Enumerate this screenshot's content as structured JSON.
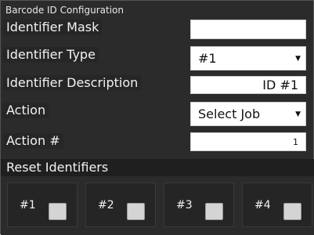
{
  "panel": {
    "title": "Barcode ID Configuration",
    "identifier_mask": {
      "label": "Identifier Mask",
      "value": ""
    },
    "identifier_type": {
      "label": "Identifier Type",
      "value": "#1"
    },
    "identifier_description": {
      "label": "Identifier Description",
      "value": "ID #1"
    },
    "action": {
      "label": "Action",
      "value": "Select Job"
    },
    "action_number": {
      "label": "Action #",
      "value": "1"
    },
    "reset": {
      "label": "Reset Identifiers",
      "items": [
        {
          "label": "#1",
          "checked": false
        },
        {
          "label": "#2",
          "checked": false
        },
        {
          "label": "#3",
          "checked": false
        },
        {
          "label": "#4",
          "checked": false
        }
      ]
    }
  }
}
